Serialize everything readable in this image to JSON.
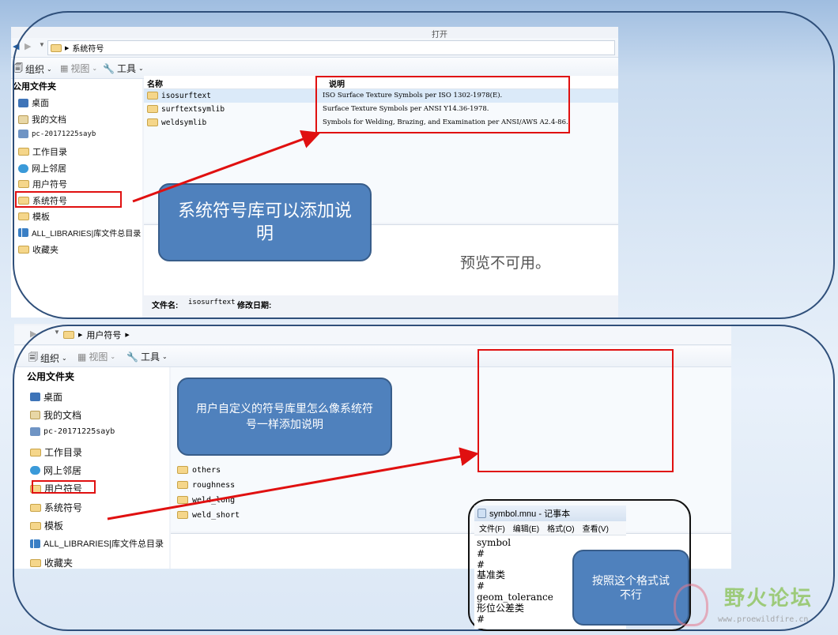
{
  "top": {
    "dialog_title": "打开",
    "breadcrumb": "系统符号",
    "toolbar": {
      "organize": "组织",
      "views": "视图",
      "tools": "工具"
    },
    "sidebar_header": "公用文件夹",
    "sidebar_items": [
      "桌面",
      "我的文档",
      "pc-20171225sayb",
      "工作目录",
      "网上邻居",
      "用户符号",
      "系统符号",
      "模板",
      "ALL_LIBRARIES|库文件总目录",
      "收藏夹"
    ],
    "columns": {
      "name": "名称",
      "desc": "说明"
    },
    "files": [
      {
        "name": "isosurftext",
        "desc": "ISO Surface Texture Symbols per ISO 1302-1978(E)."
      },
      {
        "name": "surftextsymlib",
        "desc": "Surface Texture Symbols per ANSI Y14.36-1978."
      },
      {
        "name": "weldsymlib",
        "desc": "Symbols for Welding, Brazing, and Examination per ANSI/AWS A2.4-86."
      }
    ],
    "preview_text": "预览不可用。",
    "filename_label": "文件名:",
    "filename_value": "isosurftext",
    "modified_label": "修改日期:",
    "callout": "系统符号库可以添加说明"
  },
  "bottom": {
    "breadcrumb": "用户符号",
    "toolbar": {
      "organize": "组织",
      "views": "视图",
      "tools": "工具"
    },
    "sidebar_header": "公用文件夹",
    "sidebar_items": [
      "桌面",
      "我的文档",
      "pc-20171225sayb",
      "工作目录",
      "网上邻居",
      "用户符号",
      "系统符号",
      "模板",
      "ALL_LIBRARIES|库文件总目录",
      "收藏夹"
    ],
    "files": [
      "others",
      "roughness",
      "weld_long",
      "weld_short"
    ],
    "callout": "用户自定义的符号库里怎么像系统符号一样添加说明"
  },
  "notepad": {
    "title": "symbol.mnu - 记事本",
    "menu": [
      "文件(F)",
      "编辑(E)",
      "格式(O)",
      "查看(V)"
    ],
    "lines": [
      "symbol",
      "#",
      "#",
      "基准类",
      "#",
      "geom_tolerance",
      "形位公差类",
      "#"
    ],
    "callout": "按照这个格式试不行"
  },
  "watermark": {
    "name": "野火论坛",
    "url": "www.proewildfire.cn"
  },
  "colors": {
    "accent": "#4f81bd",
    "highlight": "#e01010",
    "frame": "#2f4f7a"
  }
}
